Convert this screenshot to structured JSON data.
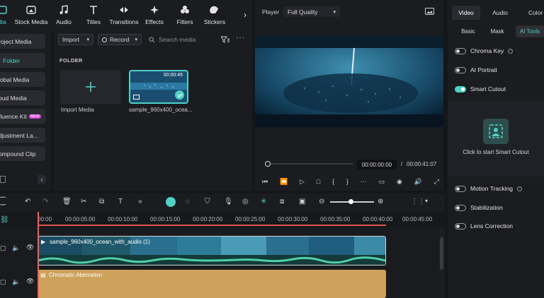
{
  "media_toolbar": {
    "items": [
      {
        "label": "dia",
        "icon": "media-icon"
      },
      {
        "label": "Stock Media",
        "icon": "stock-media-icon"
      },
      {
        "label": "Audio",
        "icon": "audio-icon"
      },
      {
        "label": "Titles",
        "icon": "titles-icon"
      },
      {
        "label": "Transitions",
        "icon": "transitions-icon"
      },
      {
        "label": "Effects",
        "icon": "effects-icon"
      },
      {
        "label": "Filters",
        "icon": "filters-icon"
      },
      {
        "label": "Stickers",
        "icon": "stickers-icon"
      }
    ]
  },
  "left_nav": {
    "items": [
      {
        "label": "roject Media"
      },
      {
        "label": "Folder"
      },
      {
        "label": "lobal Media"
      },
      {
        "label": "oud Media"
      },
      {
        "label": "fluence Kit",
        "badge": "NEW"
      },
      {
        "label": "djustment La..."
      },
      {
        "label": "ompound Clip"
      }
    ]
  },
  "media": {
    "import_label": "Import",
    "record_label": "Record",
    "search_placeholder": "Search media",
    "folder_heading": "FOLDER",
    "import_media_label": "Import Media",
    "clip_name": "sample_960x400_ocea...",
    "clip_duration": "00:00:46"
  },
  "player": {
    "label": "Player",
    "quality": "Full Quality",
    "current_time": "00:00:00:00",
    "separator": "/",
    "total_time": "00:00:41:07"
  },
  "right_panel": {
    "tabs": [
      "Video",
      "Audio",
      "Color"
    ],
    "subtabs": [
      "Basic",
      "Mask",
      "AI Tools"
    ],
    "toggles": [
      {
        "label": "Chroma Key",
        "on": false,
        "info": true
      },
      {
        "label": "AI Portrait",
        "on": false,
        "info": false
      },
      {
        "label": "Smart Cutout",
        "on": true,
        "info": false
      }
    ],
    "cutout_label": "Click to start Smart Cutout",
    "toggles2": [
      {
        "label": "Motion Tracking",
        "on": false,
        "info": true
      },
      {
        "label": "Stabilization",
        "on": false,
        "info": false
      },
      {
        "label": "Lens Correction",
        "on": false,
        "info": false
      }
    ]
  },
  "timeline": {
    "ticks": [
      "00:00",
      "00:00:05:00",
      "00:00:10:00",
      "00:00:15:00",
      "00:00:20:00",
      "00:00:25:00",
      "00:00:30:00",
      "00:00:35:00",
      "00:00:40:00",
      "00:00:45:00"
    ],
    "video_clip_label": "sample_960x400_ocean_with_audio (1)",
    "fx_clip_label": "Chromatic Aberration"
  }
}
